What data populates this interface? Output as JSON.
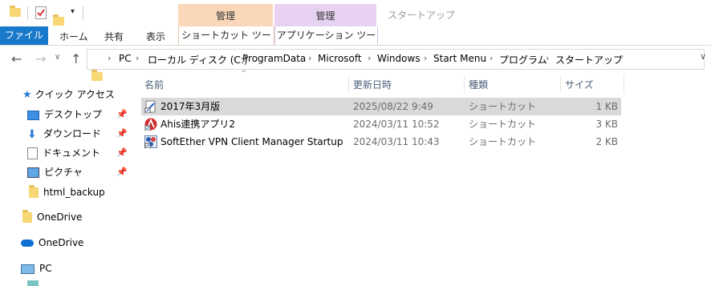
{
  "window": {
    "title": "スタートアップ",
    "context_tabs": [
      {
        "label": "管理",
        "sub": "ショートカット ツール",
        "color": "#f9d7b8"
      },
      {
        "label": "管理",
        "sub": "アプリケーション ツール",
        "color": "#e8d2f2"
      }
    ]
  },
  "ribbon": {
    "file_tab": "ファイル",
    "tabs": [
      "ホーム",
      "共有",
      "表示"
    ]
  },
  "address": {
    "root": "PC",
    "crumbs": [
      "ローカル ディスク (C:)",
      "ProgramData",
      "Microsoft",
      "Windows",
      "Start Menu",
      "プログラム",
      "スタートアップ"
    ]
  },
  "nav_pane": {
    "quick_access": "クイック アクセス",
    "pinned": [
      "デスクトップ",
      "ダウンロード",
      "ドキュメント",
      "ピクチャ"
    ],
    "folders": [
      "html_backup"
    ],
    "onedrive_1": "OneDrive",
    "onedrive_2": "OneDrive",
    "pc": "PC"
  },
  "list": {
    "columns": {
      "name": "名前",
      "date": "更新日時",
      "type": "種類",
      "size": "サイズ"
    },
    "rows": [
      {
        "name": "2017年3月版",
        "date": "2025/08/22 9:49",
        "type": "ショートカット",
        "size": "1 KB",
        "selected": true,
        "icon": "shortcut-doc-icon"
      },
      {
        "name": "Ahis連携アプリ2",
        "date": "2024/03/11 10:52",
        "type": "ショートカット",
        "size": "3 KB",
        "selected": false,
        "icon": "ahis-app-icon"
      },
      {
        "name": "SoftEther VPN Client Manager Startup",
        "date": "2024/03/11 10:43",
        "type": "ショートカット",
        "size": "2 KB",
        "selected": false,
        "icon": "softether-icon"
      }
    ]
  },
  "colors": {
    "accent": "#1979ca",
    "selection": "#d9d9d9",
    "folder": "#f8d775"
  }
}
